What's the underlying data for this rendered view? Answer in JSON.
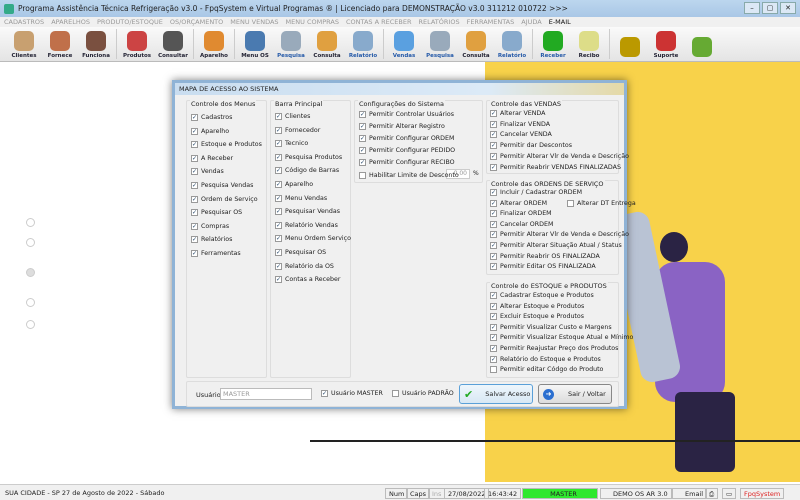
{
  "window": {
    "title": "Programa Assistência Técnica Refrigeração v3.0 - FpqSystem e Virtual Programas ® | Licenciado para  DEMONSTRAÇÃO v3.0 311212 010722 >>>"
  },
  "menu": [
    "CADASTROS",
    "APARELHOS",
    "PRODUTO/ESTOQUE",
    "OS/ORÇAMENTO",
    "MENU VENDAS",
    "MENU COMPRAS",
    "CONTAS A RECEBER",
    "RELATÓRIOS",
    "FERRAMENTAS",
    "AJUDA",
    "E-MAIL"
  ],
  "toolbar": [
    {
      "label": "Clientes",
      "icon": "clients-icon",
      "color": "#c8a070"
    },
    {
      "label": "Fornece",
      "icon": "supplier-icon",
      "color": "#c0704a"
    },
    {
      "label": "Funciona",
      "icon": "employee-icon",
      "color": "#7a5040"
    },
    {
      "label": "Produtos",
      "icon": "products-icon",
      "color": "#c44"
    },
    {
      "label": "Consultar",
      "icon": "barcode-icon",
      "color": "#555"
    },
    {
      "label": "Aparelho",
      "icon": "appliance-icon",
      "color": "#e08a30"
    },
    {
      "label": "Menu OS",
      "icon": "tools-icon",
      "color": "#4a7ab0"
    },
    {
      "label": "Pesquisa",
      "icon": "search-doc-icon",
      "color": "#9ab",
      "blue": true
    },
    {
      "label": "Consulta",
      "icon": "folder-icon",
      "color": "#e0a040"
    },
    {
      "label": "Relatório",
      "icon": "printer-icon",
      "color": "#8ac",
      "blue": true
    },
    {
      "label": "Vendas",
      "icon": "monitor-icon",
      "color": "#5aa0e0",
      "blue": true
    },
    {
      "label": "Pesquisa",
      "icon": "search-doc-icon",
      "color": "#9ab",
      "blue": true
    },
    {
      "label": "Consulta",
      "icon": "folder-icon",
      "color": "#e0a040"
    },
    {
      "label": "Relatório",
      "icon": "printer-icon",
      "color": "#8ac",
      "blue": true
    },
    {
      "label": "Receber",
      "icon": "dollar-icon",
      "color": "#2a2",
      "blue": true
    },
    {
      "label": "Recibo",
      "icon": "receipt-icon",
      "color": "#dd8"
    },
    {
      "label": "",
      "icon": "coins-icon",
      "color": "#b90"
    },
    {
      "label": "Suporte",
      "icon": "support-icon",
      "color": "#c33"
    },
    {
      "label": "",
      "icon": "exit-icon",
      "color": "#6a3"
    }
  ],
  "dialog": {
    "title": "MAPA DE ACESSO AO SISTEMA",
    "groups": {
      "menus": {
        "title": "Controle dos Menus",
        "items": [
          {
            "label": "Cadastros",
            "checked": true
          },
          {
            "label": "Aparelho",
            "checked": true
          },
          {
            "label": "Estoque e Produtos",
            "checked": true
          },
          {
            "label": "A Receber",
            "checked": true
          },
          {
            "label": "Vendas",
            "checked": true
          },
          {
            "label": "Pesquisa Vendas",
            "checked": true
          },
          {
            "label": "Ordem de Serviço",
            "checked": true
          },
          {
            "label": "Pesquisar OS",
            "checked": true
          },
          {
            "label": "Compras",
            "checked": true
          },
          {
            "label": "Relatórios",
            "checked": true
          },
          {
            "label": "Ferramentas",
            "checked": true
          }
        ]
      },
      "barra": {
        "title": "Barra Principal",
        "items": [
          {
            "label": "Clientes",
            "checked": true
          },
          {
            "label": "Fornecedor",
            "checked": true
          },
          {
            "label": "Tecnico",
            "checked": true
          },
          {
            "label": "Pesquisa Produtos",
            "checked": true
          },
          {
            "label": "Código de Barras",
            "checked": true
          },
          {
            "label": "Aparelho",
            "checked": true
          },
          {
            "label": "Menu Vendas",
            "checked": true
          },
          {
            "label": "Pesquisar Vendas",
            "checked": true
          },
          {
            "label": "Relatório Vendas",
            "checked": true
          },
          {
            "label": "Menu Ordem Serviço",
            "checked": true
          },
          {
            "label": "Pesquisar OS",
            "checked": true
          },
          {
            "label": "Relatório da OS",
            "checked": true
          },
          {
            "label": "Contas a Receber",
            "checked": true
          }
        ]
      },
      "config": {
        "title": "Configurações do Sistema",
        "items": [
          {
            "label": "Permitir Controlar Usuários",
            "checked": true
          },
          {
            "label": "Permitir Alterar Registro",
            "checked": true
          },
          {
            "label": "Permitir Configurar ORDEM",
            "checked": true
          },
          {
            "label": "Permitir Configurar PEDIDO",
            "checked": true
          },
          {
            "label": "Permitir Configurar RECIBO",
            "checked": true
          },
          {
            "label": "Habilitar Limite de Desconto",
            "checked": false
          }
        ],
        "discount_value": "0.00",
        "discount_unit": "%"
      },
      "vendas": {
        "title": "Controle das VENDAS",
        "items": [
          {
            "label": "Alterar VENDA",
            "checked": true
          },
          {
            "label": "Finalizar VENDA",
            "checked": true
          },
          {
            "label": "Cancelar VENDA",
            "checked": true
          },
          {
            "label": "Permitir dar Descontos",
            "checked": true
          },
          {
            "label": "Permitir Alterar Vlr de Venda e Descrição",
            "checked": true
          },
          {
            "label": "Permitir Reabrir VENDAS FINALIZADAS",
            "checked": true
          }
        ]
      },
      "os": {
        "title": "Controle das ORDENS DE SERVIÇO",
        "items": [
          {
            "label": "Incluir / Cadastrar ORDEM",
            "checked": true
          },
          {
            "label": "Alterar ORDEM",
            "checked": true
          },
          {
            "label": "Finalizar ORDEM",
            "checked": true
          },
          {
            "label": "Cancelar ORDEM",
            "checked": true
          },
          {
            "label": "Permitir Alterar Vlr de Venda e Descrição",
            "checked": true
          },
          {
            "label": "Permitir Alterar Situação Atual / Status",
            "checked": true
          },
          {
            "label": "Permitir Reabrir OS FINALIZADA",
            "checked": true
          },
          {
            "label": "Permitir Editar OS FINALIZADA",
            "checked": true
          }
        ],
        "extra": {
          "label": "Alterar DT Entrega",
          "checked": false
        }
      },
      "estoque": {
        "title": "Controle do ESTOQUE e PRODUTOS",
        "items": [
          {
            "label": "Cadastrar Estoque e Produtos",
            "checked": true
          },
          {
            "label": "Alterar Estoque e Produtos",
            "checked": true
          },
          {
            "label": "Excluir Estoque e Produtos",
            "checked": true
          },
          {
            "label": "Permitir Visualizar Custo e Margens",
            "checked": true
          },
          {
            "label": "Permitir Visualizar Estoque Atual e Mínimo",
            "checked": true
          },
          {
            "label": "Permitir Reajustar Preço dos Produtos",
            "checked": true
          },
          {
            "label": "Relatório do Estoque e Produtos",
            "checked": true
          },
          {
            "label": "Permitir editar Códgo do Produto",
            "checked": false
          }
        ]
      }
    },
    "user_label": "Usuário:",
    "user_value": "MASTER",
    "master": {
      "label": "Usuário MASTER",
      "checked": true
    },
    "padrao": {
      "label": "Usuário PADRÃO",
      "checked": false
    },
    "save_label": "Salvar Acesso",
    "exit_label": "Sair / Voltar"
  },
  "status": {
    "city": "SUA CIDADE - SP 27 de Agosto de 2022 - Sábado",
    "num": "Num",
    "caps": "Caps",
    "ins": "Ins",
    "date": "27/08/2022",
    "time": "16:43:42",
    "user": "MASTER",
    "version": "DEMO OS AR 3.0",
    "email": "Email",
    "brand": "FpqSystem"
  },
  "colors": {
    "accent_yellow": "#f8d24a",
    "master_green": "#2ee82e",
    "dialog_border": "#8fb3d6"
  }
}
